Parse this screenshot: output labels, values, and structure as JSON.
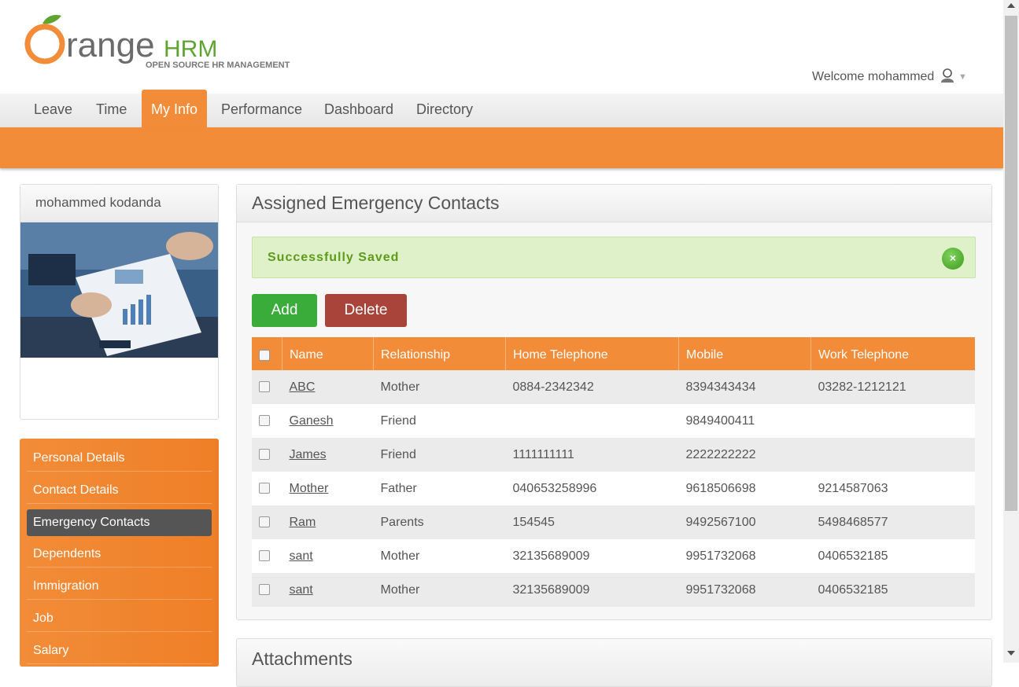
{
  "header": {
    "logo_brand": "OrangeHRM",
    "logo_tagline": "OPEN SOURCE HR MANAGEMENT",
    "welcome_text": "Welcome mohammed"
  },
  "nav": {
    "items": [
      {
        "label": "Leave"
      },
      {
        "label": "Time"
      },
      {
        "label": "My Info",
        "active": true
      },
      {
        "label": "Performance"
      },
      {
        "label": "Dashboard"
      },
      {
        "label": "Directory"
      }
    ]
  },
  "profile": {
    "name": "mohammed kodanda"
  },
  "sidemenu": {
    "items": [
      {
        "label": "Personal Details"
      },
      {
        "label": "Contact Details"
      },
      {
        "label": "Emergency Contacts",
        "active": true
      },
      {
        "label": "Dependents"
      },
      {
        "label": "Immigration"
      },
      {
        "label": "Job"
      },
      {
        "label": "Salary"
      }
    ]
  },
  "panel": {
    "title": "Assigned Emergency Contacts",
    "message": "Successfully Saved",
    "close_label": "×",
    "add_label": "Add",
    "delete_label": "Delete",
    "columns": [
      "Name",
      "Relationship",
      "Home Telephone",
      "Mobile",
      "Work Telephone"
    ],
    "rows": [
      {
        "name": "ABC",
        "relationship": "Mother",
        "home": "0884-2342342",
        "mobile": "8394343434",
        "work": "03282-1212121"
      },
      {
        "name": "Ganesh",
        "relationship": "Friend",
        "home": "",
        "mobile": "9849400411",
        "work": ""
      },
      {
        "name": "James",
        "relationship": "Friend",
        "home": "1111111111",
        "mobile": "2222222222",
        "work": ""
      },
      {
        "name": "Mother",
        "relationship": "Father",
        "home": "040653258996",
        "mobile": "9618506698",
        "work": "9214587063"
      },
      {
        "name": "Ram",
        "relationship": "Parents",
        "home": "154545",
        "mobile": "9492567100",
        "work": "5498468577"
      },
      {
        "name": "sant",
        "relationship": "Mother",
        "home": "32135689009",
        "mobile": "9951732068",
        "work": "0406532185"
      },
      {
        "name": "sant",
        "relationship": "Mother",
        "home": "32135689009",
        "mobile": "9951732068",
        "work": "0406532185"
      }
    ]
  },
  "attachments": {
    "title": "Attachments"
  },
  "colors": {
    "brand_orange": "#f28c38",
    "success_green": "#3aac3a",
    "danger_red": "#a8443a"
  }
}
